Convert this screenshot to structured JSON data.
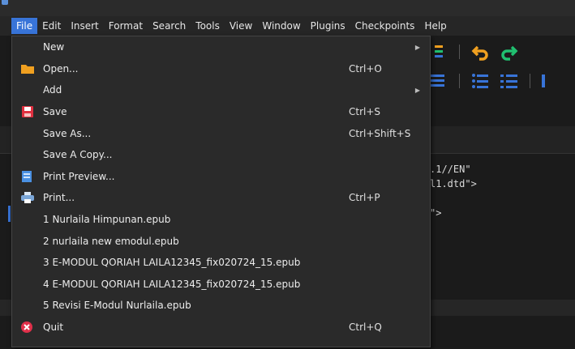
{
  "menubar": {
    "items": [
      {
        "label": "File",
        "name": "menu-file",
        "active": true
      },
      {
        "label": "Edit",
        "name": "menu-edit"
      },
      {
        "label": "Insert",
        "name": "menu-insert"
      },
      {
        "label": "Format",
        "name": "menu-format"
      },
      {
        "label": "Search",
        "name": "menu-search"
      },
      {
        "label": "Tools",
        "name": "menu-tools"
      },
      {
        "label": "View",
        "name": "menu-view"
      },
      {
        "label": "Window",
        "name": "menu-window"
      },
      {
        "label": "Plugins",
        "name": "menu-plugins"
      },
      {
        "label": "Checkpoints",
        "name": "menu-checkpoints"
      },
      {
        "label": "Help",
        "name": "menu-help"
      }
    ]
  },
  "file_menu": {
    "items": [
      {
        "label": "New",
        "name": "file-new",
        "submenu": true
      },
      {
        "label": "Open...",
        "name": "file-open",
        "shortcut": "Ctrl+O",
        "icon": "folder-icon"
      },
      {
        "label": "Add",
        "name": "file-add",
        "submenu": true
      },
      {
        "label": "Save",
        "name": "file-save",
        "shortcut": "Ctrl+S",
        "icon": "save-icon"
      },
      {
        "label": "Save As...",
        "name": "file-save-as",
        "shortcut": "Ctrl+Shift+S"
      },
      {
        "label": "Save A Copy...",
        "name": "file-save-copy"
      },
      {
        "label": "Print Preview...",
        "name": "file-print-preview",
        "icon": "print-preview-icon"
      },
      {
        "label": "Print...",
        "name": "file-print",
        "shortcut": "Ctrl+P",
        "icon": "printer-icon"
      },
      {
        "label": "1 Nurlaila Himpunan.epub",
        "name": "recent-file-1"
      },
      {
        "label": "2 nurlaila new emodul.epub",
        "name": "recent-file-2"
      },
      {
        "label": "3 E-MODUL QORIAH LAILA12345_fix020724_15.epub",
        "name": "recent-file-3"
      },
      {
        "label": "4 E-MODUL QORIAH LAILA12345_fix020724_15.epub",
        "name": "recent-file-4"
      },
      {
        "label": "5 Revisi E-Modul Nurlaila.epub",
        "name": "recent-file-5"
      },
      {
        "label": "Quit",
        "name": "file-quit",
        "shortcut": "Ctrl+Q",
        "icon": "quit-icon"
      }
    ]
  },
  "editor": {
    "code_lines": [
      ".1//EN\"",
      "l1.dtd\">",
      "\">"
    ]
  },
  "colors": {
    "accent": "#3874d8",
    "menu_bg": "#2a2a2a",
    "undo_orange": "#f0a020",
    "redo_green": "#20c070"
  }
}
